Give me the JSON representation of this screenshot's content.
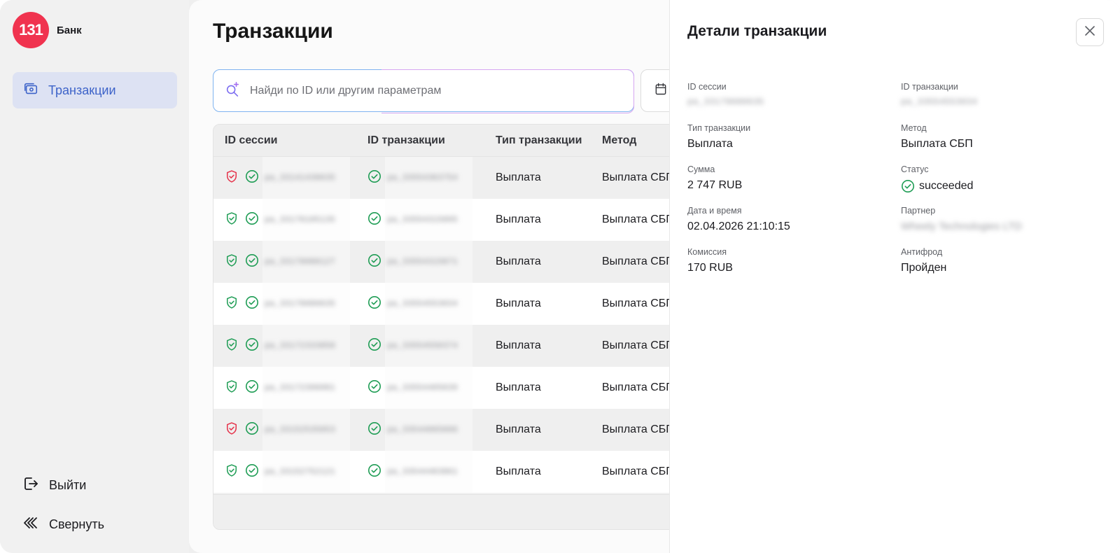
{
  "sidebar": {
    "logo_number": "131",
    "logo_text": "Банк",
    "nav_transactions": "Транзакции",
    "logout": "Выйти",
    "collapse": "Свернуть"
  },
  "main": {
    "title": "Транзакции",
    "search_placeholder": "Найди по ID или другим параметрам",
    "columns": [
      "ID сессии",
      "ID транзакции",
      "Тип транзакции",
      "Метод"
    ],
    "rows": [
      {
        "session_id": "pa_33141438635",
        "shield": "red",
        "tx_id": "pa_33554363754",
        "type": "Выплата",
        "method": "Выплата СБП"
      },
      {
        "session_id": "pa_33178105135",
        "shield": "green",
        "tx_id": "pa_33554315895",
        "type": "Выплата",
        "method": "Выплата СБП"
      },
      {
        "session_id": "pa_33178088127",
        "shield": "green",
        "tx_id": "pa_33554315871",
        "type": "Выплата",
        "method": "Выплата СБП"
      },
      {
        "session_id": "pa_33178080635",
        "shield": "green",
        "tx_id": "pa_33554553034",
        "type": "Выплата",
        "method": "Выплата СБП"
      },
      {
        "session_id": "pa_33172333858",
        "shield": "green",
        "tx_id": "pa_33554550374",
        "type": "Выплата",
        "method": "Выплата СБП"
      },
      {
        "session_id": "pa_33172396081",
        "shield": "green",
        "tx_id": "pa_33554405639",
        "type": "Выплата",
        "method": "Выплата СБП"
      },
      {
        "session_id": "pa_33152535053",
        "shield": "red",
        "tx_id": "pa_33544065666",
        "type": "Выплата",
        "method": "Выплата СБП"
      },
      {
        "session_id": "pa_33152752121",
        "shield": "green",
        "tx_id": "pa_33544483861",
        "type": "Выплата",
        "method": "Выплата СБП"
      }
    ]
  },
  "details": {
    "title": "Детали транзакции",
    "session_id_label": "ID сессии",
    "session_id_value": "pa_33178080635",
    "tx_id_label": "ID транзакции",
    "tx_id_value": "pa_33554553034",
    "type_label": "Тип транзакции",
    "type_value": "Выплата",
    "method_label": "Метод",
    "method_value": "Выплата СБП",
    "amount_label": "Сумма",
    "amount_value": "2 747 RUB",
    "status_label": "Статус",
    "status_value": "succeeded",
    "datetime_label": "Дата и время",
    "datetime_value": "02.04.2026 21:10:15",
    "partner_label": "Партнер",
    "partner_value": "Wheely Technologies LTD",
    "fee_label": "Комиссия",
    "fee_value": "170 RUB",
    "antifraud_label": "Антифрод",
    "antifraud_value": "Пройден"
  },
  "colors": {
    "brand_red": "#f0334f",
    "accent_blue": "#3d63c9",
    "success_green": "#1f9d55",
    "danger_red": "#e5324a"
  },
  "icons": {
    "nav": "wallet-icon",
    "logout": "logout-icon",
    "collapse": "chevrons-left-icon",
    "search": "sparkle-search-icon",
    "date": "calendar-icon",
    "close": "close-icon",
    "shield": "shield-check-icon",
    "check": "check-circle-icon"
  }
}
